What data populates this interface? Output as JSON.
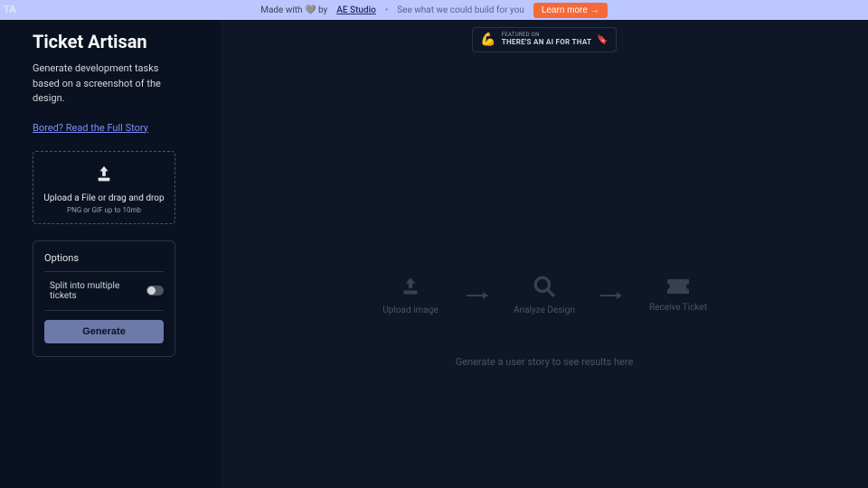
{
  "banner": {
    "made_with": "Made with 🩶 by",
    "studio": "AE Studio",
    "see": "See what we could build for you",
    "learn": "Learn more →"
  },
  "logo": "TA",
  "sidebar": {
    "title": "Ticket Artisan",
    "subtitle": "Generate development tasks based on a screenshot of the design.",
    "story_link": "Bored? Read the Full Story",
    "upload": {
      "title": "Upload a File or drag and drop",
      "sub": "PNG or GIF up to 10mb"
    },
    "options": {
      "title": "Options",
      "split_label": "Split into multiple tickets",
      "generate": "Generate"
    }
  },
  "featured": {
    "small": "FEATURED ON",
    "big": "THERE'S AN AI FOR THAT"
  },
  "flow": {
    "step1": "Upload image",
    "step2": "Analyze Design",
    "step3": "Receive Ticket",
    "hint": "Generate a user story to see results here"
  }
}
